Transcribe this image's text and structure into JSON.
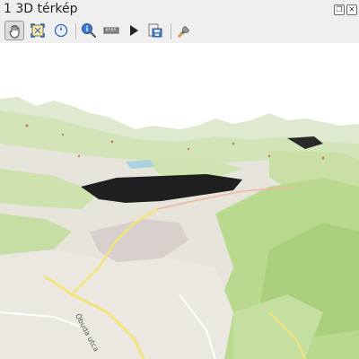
{
  "window": {
    "title": "1 3D térkép",
    "float_icon": "restore-icon",
    "close_icon": "close-icon"
  },
  "toolbar": {
    "buttons": [
      {
        "name": "pan-tool",
        "icon": "hand-icon",
        "active": true
      },
      {
        "name": "zoom-full",
        "icon": "zoom-full-icon"
      },
      {
        "name": "camera-north",
        "icon": "compass-icon"
      },
      {
        "name": "identify",
        "icon": "identify-icon"
      },
      {
        "name": "measure",
        "icon": "ruler-icon"
      },
      {
        "name": "animation",
        "icon": "play-icon"
      },
      {
        "name": "export-image",
        "icon": "save-image-icon"
      },
      {
        "name": "configure",
        "icon": "wrench-icon"
      }
    ]
  },
  "map": {
    "road_labels": [
      "Óbuda utca"
    ],
    "colors": {
      "sky": "#ffffff",
      "terrain": "#e9e6df",
      "forest": "#c7dfa6",
      "urban": "#dcd4d0",
      "road": "#f5e37b",
      "water": "#aad3df"
    }
  }
}
